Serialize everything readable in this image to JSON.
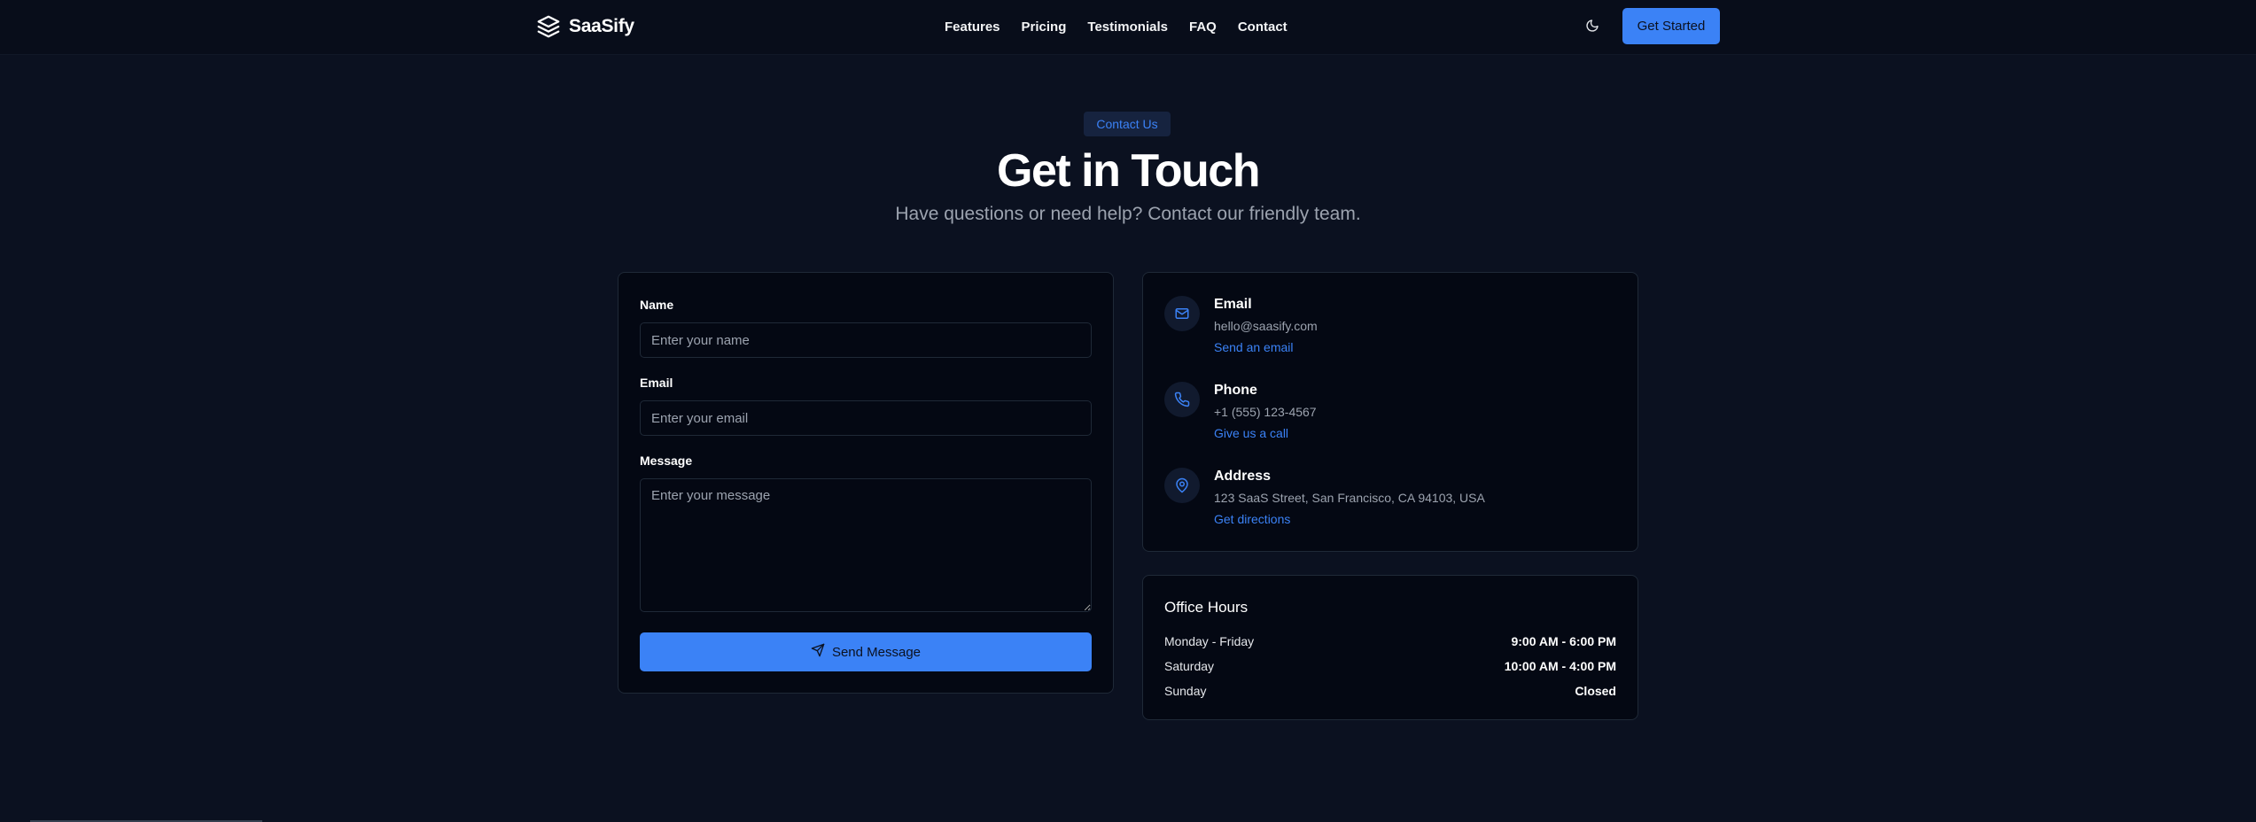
{
  "header": {
    "brand": "SaaSify",
    "nav": [
      "Features",
      "Pricing",
      "Testimonials",
      "FAQ",
      "Contact"
    ],
    "cta_label": "Get Started",
    "theme_icon": "moon-icon"
  },
  "hero": {
    "badge": "Contact Us",
    "title": "Get in Touch",
    "subtitle": "Have questions or need help? Contact our friendly team."
  },
  "form": {
    "name_label": "Name",
    "name_placeholder": "Enter your name",
    "email_label": "Email",
    "email_placeholder": "Enter your email",
    "message_label": "Message",
    "message_placeholder": "Enter your message",
    "submit_label": "Send Message"
  },
  "contact": {
    "items": [
      {
        "title": "Email",
        "value": "hello@saasify.com",
        "link": "Send an email",
        "icon": "mail-icon"
      },
      {
        "title": "Phone",
        "value": "+1 (555) 123-4567",
        "link": "Give us a call",
        "icon": "phone-icon"
      },
      {
        "title": "Address",
        "value": "123 SaaS Street, San Francisco, CA 94103, USA",
        "link": "Get directions",
        "icon": "map-pin-icon"
      }
    ]
  },
  "hours": {
    "title": "Office Hours",
    "rows": [
      {
        "day": "Monday - Friday",
        "time": "9:00 AM - 6:00 PM"
      },
      {
        "day": "Saturday",
        "time": "10:00 AM - 4:00 PM"
      },
      {
        "day": "Sunday",
        "time": "Closed"
      }
    ]
  },
  "colors": {
    "background": "#0b1120",
    "card": "#040813",
    "accent": "#3b82f6",
    "muted_text": "#9ca3af"
  }
}
